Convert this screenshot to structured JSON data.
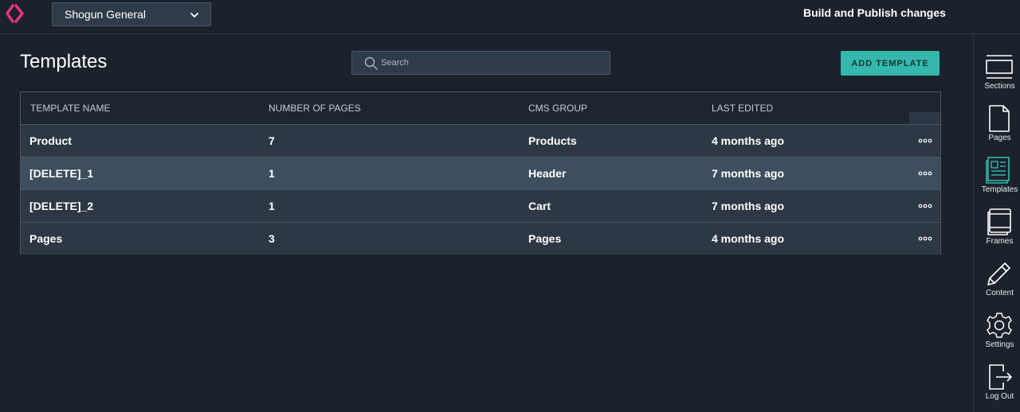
{
  "topbar": {
    "store_name": "Shogun General",
    "publish_label": "Build and Publish changes"
  },
  "main": {
    "title": "Templates",
    "search_placeholder": "Search",
    "add_button_label": "ADD TEMPLATE"
  },
  "table": {
    "headers": [
      "TEMPLATE NAME",
      "NUMBER OF PAGES",
      "CMS GROUP",
      "LAST EDITED"
    ],
    "rows": [
      {
        "name": "Product",
        "pages": "7",
        "group": "Products",
        "edited": "4 months ago"
      },
      {
        "name": "[DELETE]_1",
        "pages": "1",
        "group": "Header",
        "edited": "7 months ago"
      },
      {
        "name": "[DELETE]_2",
        "pages": "1",
        "group": "Cart",
        "edited": "7 months ago"
      },
      {
        "name": "Pages",
        "pages": "3",
        "group": "Pages",
        "edited": "4 months ago"
      }
    ],
    "highlighted_row": 1
  },
  "sidebar": {
    "items": [
      {
        "label": "Sections",
        "icon": "sections-icon"
      },
      {
        "label": "Pages",
        "icon": "page-icon"
      },
      {
        "label": "Templates",
        "icon": "templates-icon",
        "active": true
      },
      {
        "label": "Frames",
        "icon": "frames-icon"
      },
      {
        "label": "Content",
        "icon": "pencil-icon"
      },
      {
        "label": "Settings",
        "icon": "gear-icon"
      },
      {
        "label": "Log Out",
        "icon": "logout-icon"
      }
    ]
  },
  "colors": {
    "background": "#1b222c",
    "accent": "#35b8ab",
    "brand_logo": "#e6347a",
    "row_bg": "#2e3844",
    "row_highlight": "#3e4e5e"
  }
}
